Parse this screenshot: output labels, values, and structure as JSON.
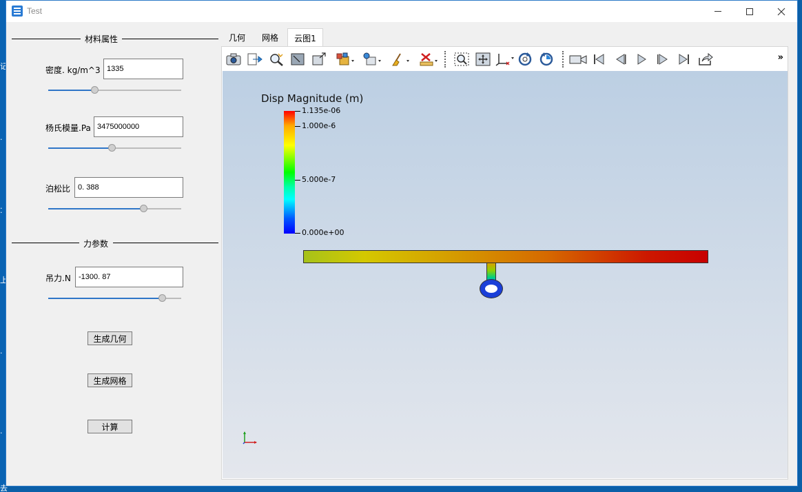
{
  "window": {
    "title": "Test"
  },
  "desktop_fragments": [
    "记",
    "·",
    "·",
    "·",
    "上",
    "·",
    "·",
    "去"
  ],
  "material_group": {
    "title": "材料属性"
  },
  "properties": {
    "density": {
      "label": "密度. kg/m^3",
      "value": "1335",
      "slider_fraction": 0.34
    },
    "youngs": {
      "label": "杨氏模量.Pa",
      "value": "3475000000",
      "slider_fraction": 0.48
    },
    "poisson": {
      "label": "泊松比",
      "value": "0. 388",
      "slider_fraction": 0.73
    }
  },
  "force_group": {
    "title": "力参数"
  },
  "force": {
    "label": "吊力.N",
    "value": "-1300. 87",
    "slider_fraction": 0.88
  },
  "buttons": {
    "gen_geometry": "生成几何",
    "gen_mesh": "生成网格",
    "compute": "计算"
  },
  "tabs": [
    {
      "label": "几何",
      "active": false
    },
    {
      "label": "网格",
      "active": false
    },
    {
      "label": "云图1",
      "active": true
    }
  ],
  "toolbar": {
    "icons": [
      "camera-icon",
      "export-icon",
      "zoom-to-data-icon",
      "zoom-to-box-icon",
      "reset-camera-icon",
      "representation-icon",
      "selection-icon",
      "clear-icon",
      "delete-icon",
      "zoom-box-icon",
      "fit-all-icon",
      "axes-orient-icon",
      "rotate-cw-icon",
      "rotate-ccw-icon",
      "video-camera-icon",
      "first-frame-icon",
      "previous-frame-icon",
      "play-icon",
      "next-frame-icon",
      "last-frame-icon",
      "share-icon"
    ],
    "more_label": "»"
  },
  "legend": {
    "title": "Disp Magnitude (m)",
    "ticks": [
      "1.135e-06",
      "1.000e-6",
      "5.000e-7",
      "0.000e+00"
    ]
  },
  "colors": {
    "accent": "#2e75c7",
    "window_border": "#2b79c7",
    "viewport_top": "#bccfe3",
    "viewport_bottom": "#e4e7ed"
  }
}
